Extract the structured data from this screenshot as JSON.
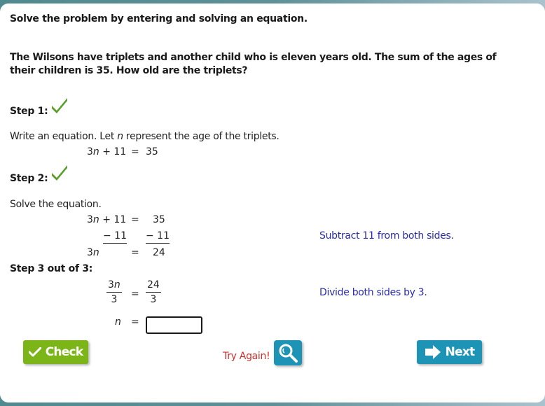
{
  "instruction": "Solve the problem by entering and solving an equation.",
  "problem": "The Wilsons have triplets and another child who is eleven years old. The sum of the ages of their children is 35. How old are the triplets?",
  "steps": [
    {
      "label": "Step 1:",
      "status": "correct",
      "status_icon": "checkmark-icon",
      "text_before": "Write an equation. Let ",
      "variable": "n",
      "text_after": " represent the age of the triplets.",
      "equation": {
        "lhs_coef": "3",
        "lhs_var": "n",
        "lhs_rest": " + 11",
        "eq": "=",
        "rhs": "35"
      }
    },
    {
      "label": "Step 2:",
      "status": "correct",
      "status_icon": "checkmark-icon",
      "text": "Solve the equation.",
      "rows": [
        {
          "lhs_coef": "3",
          "lhs_var": "n",
          "lhs_rest": " + 11",
          "eq": "=",
          "rhs": "35"
        },
        {
          "lhs_sub": "− 11",
          "rhs_sub": "− 11"
        },
        {
          "lhs_coef": "3",
          "lhs_var": "n",
          "eq": "=",
          "rhs": "24"
        }
      ],
      "hint": "Subtract 11 from both sides."
    },
    {
      "label": "Step 3 out of 3:",
      "fraction_lhs": {
        "num_coef": "3",
        "num_var": "n",
        "den": "3"
      },
      "eq": "=",
      "fraction_rhs": {
        "num": "24",
        "den": "3"
      },
      "hint": "Divide both sides by 3.",
      "answer_var": "n",
      "answer_eq": "=",
      "answer_value": ""
    }
  ],
  "buttons": {
    "check": {
      "label": "Check",
      "icon": "checkmark-icon",
      "color": "#7cb518"
    },
    "try_again": {
      "label": "Try Again!",
      "color": "#d52d2d"
    },
    "hint_search": {
      "icon": "magnifier-icon",
      "color": "#1d93b5"
    },
    "next": {
      "label": "Next",
      "icon": "arrow-right-icon",
      "color": "#1d93b5"
    }
  },
  "colors": {
    "hint_text": "#2b2bb0",
    "correct_check": "#5a9e2a",
    "frame": "#4f8a8f"
  }
}
